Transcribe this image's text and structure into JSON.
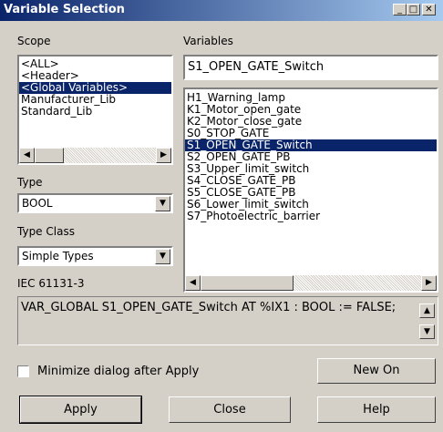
{
  "window": {
    "title": "Variable Selection",
    "minimize": "_",
    "maximize": "□",
    "close": "✕"
  },
  "scope": {
    "label": "Scope",
    "items": [
      "<ALL>",
      "<Header>",
      "<Global Variables>",
      "Manufacturer_Lib",
      "Standard_Lib"
    ],
    "selected_index": 2
  },
  "variables": {
    "label": "Variables",
    "current_value": "S1_OPEN_GATE_Switch",
    "items": [
      "H1_Warning_lamp",
      "K1_Motor_open_gate",
      "K2_Motor_close_gate",
      "S0_STOP_GATE",
      "S1_OPEN_GATE_Switch",
      "S2_OPEN_GATE_PB",
      "S3_Upper_limit_switch",
      "S4_CLOSE_GATE_PB",
      "S5_CLOSE_GATE_PB",
      "S6_Lower_limit_switch",
      "S7_Photoelectric_barrier"
    ],
    "selected_index": 4
  },
  "type": {
    "label": "Type",
    "value": "BOOL"
  },
  "type_class": {
    "label": "Type Class",
    "value": "Simple Types"
  },
  "standard_label": "IEC 61131-3",
  "declaration": "VAR_GLOBAL S1_OPEN_GATE_Switch AT %IX1 : BOOL := FALSE;",
  "minimize_option": {
    "label": "Minimize dialog after Apply",
    "checked": false
  },
  "buttons": {
    "new_on": "New On",
    "apply": "Apply",
    "close": "Close",
    "help": "Help"
  },
  "icons": {
    "left_arrow": "◀",
    "right_arrow": "▶",
    "down_arrow": "▼",
    "up_arrow": "▲"
  }
}
